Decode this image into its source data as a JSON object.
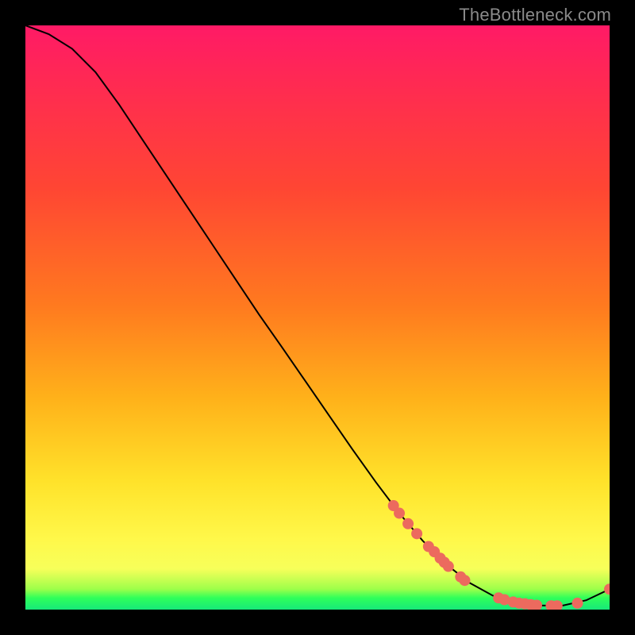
{
  "watermark": "TheBottleneck.com",
  "chart_data": {
    "type": "line",
    "title": "",
    "xlabel": "",
    "ylabel": "",
    "xlim": [
      0,
      100
    ],
    "ylim": [
      0,
      100
    ],
    "grid": false,
    "legend": "none",
    "series": [
      {
        "name": "curve",
        "color": "#000000",
        "stroke_width": 2,
        "x": [
          0,
          4,
          8,
          12,
          16,
          20,
          24,
          28,
          32,
          36,
          40,
          44,
          48,
          52,
          56,
          60,
          64,
          68,
          72,
          76,
          80,
          84,
          88,
          92,
          96,
          100
        ],
        "y": [
          100,
          98.5,
          96,
          92,
          86.5,
          80.5,
          74.5,
          68.5,
          62.5,
          56.5,
          50.5,
          44.8,
          39,
          33.2,
          27.4,
          21.8,
          16.5,
          11.8,
          7.8,
          4.6,
          2.4,
          1.2,
          0.7,
          0.7,
          1.6,
          3.5
        ]
      }
    ],
    "markers": {
      "name": "highlighted-points",
      "color": "#ec6a5e",
      "radius": 7,
      "points": [
        {
          "x": 63,
          "y": 17.8
        },
        {
          "x": 64,
          "y": 16.5
        },
        {
          "x": 65.5,
          "y": 14.7
        },
        {
          "x": 67,
          "y": 13.0
        },
        {
          "x": 69,
          "y": 10.8
        },
        {
          "x": 70,
          "y": 9.9
        },
        {
          "x": 71,
          "y": 8.8
        },
        {
          "x": 71.7,
          "y": 8.1
        },
        {
          "x": 72.4,
          "y": 7.4
        },
        {
          "x": 74.5,
          "y": 5.6
        },
        {
          "x": 75.2,
          "y": 5.0
        },
        {
          "x": 81,
          "y": 2.0
        },
        {
          "x": 82,
          "y": 1.7
        },
        {
          "x": 83.5,
          "y": 1.3
        },
        {
          "x": 84.5,
          "y": 1.1
        },
        {
          "x": 85.5,
          "y": 1.0
        },
        {
          "x": 86.5,
          "y": 0.85
        },
        {
          "x": 87.5,
          "y": 0.75
        },
        {
          "x": 90,
          "y": 0.65
        },
        {
          "x": 91,
          "y": 0.65
        },
        {
          "x": 94.5,
          "y": 1.1
        },
        {
          "x": 100,
          "y": 3.5
        }
      ]
    }
  }
}
